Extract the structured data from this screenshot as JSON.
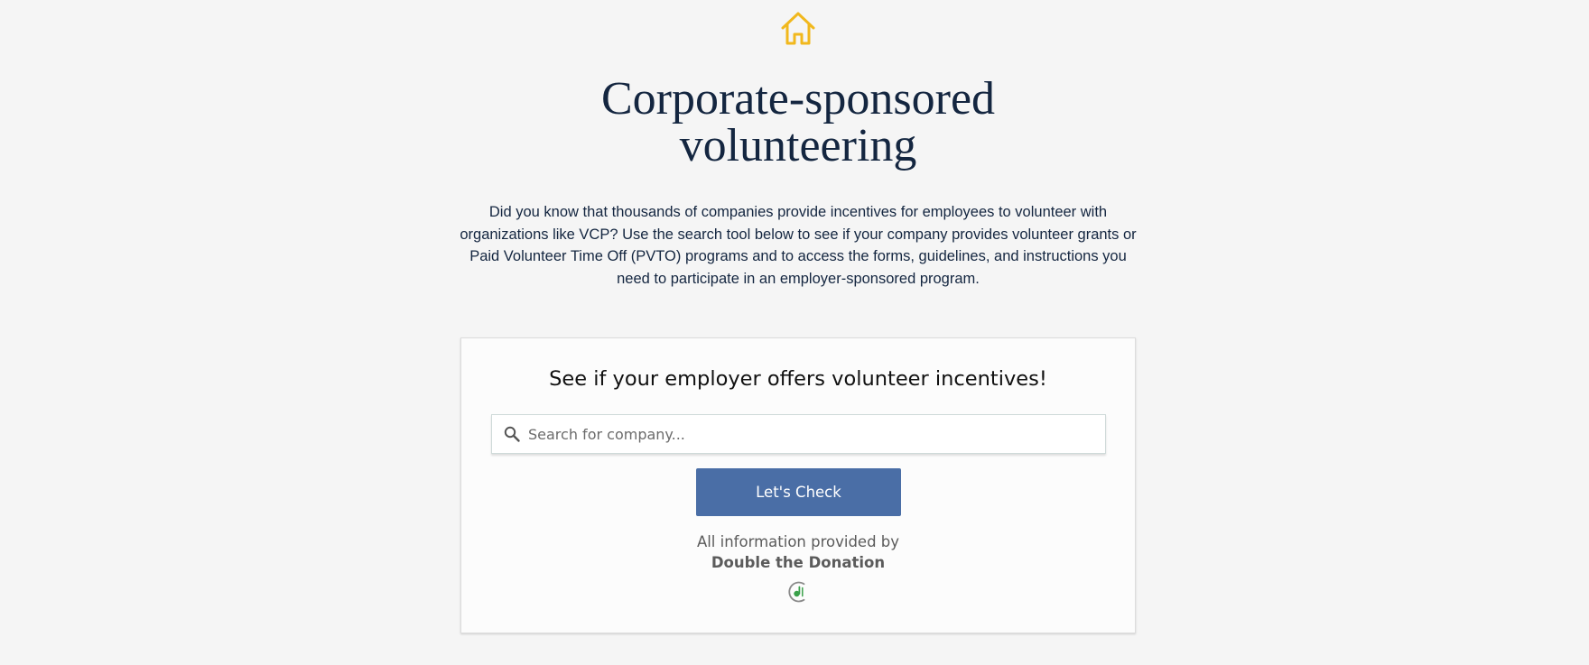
{
  "icons": {
    "home": "home-icon",
    "search": "search-icon",
    "provider_logo": "double-the-donation-logo"
  },
  "colors": {
    "home_icon": "#f1b81d",
    "title": "#142640",
    "button": "#4a6ea6",
    "logo_green": "#3aa14a"
  },
  "header": {
    "title_line1": "Corporate-sponsored",
    "title_line2": "volunteering",
    "intro": "Did you know that thousands of companies provide incentives for employees to volunteer with organizations like VCP? Use the search tool below to see if your company provides volunteer grants or Paid Volunteer Time Off (PVTO) programs and to access the forms, guidelines, and instructions you need to participate in an employer-sponsored program."
  },
  "search_card": {
    "heading": "See if your employer offers volunteer incentives!",
    "search_placeholder": "Search for company...",
    "search_value": "",
    "button_label": "Let's Check",
    "provided_by": "All information provided by",
    "provider_name": "Double the Donation"
  }
}
